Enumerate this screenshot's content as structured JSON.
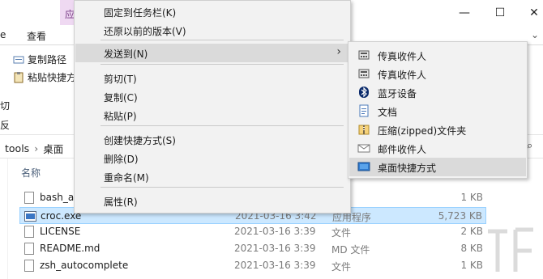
{
  "window": {
    "app_tab_label": "应",
    "ribbon_tabs": [
      "查看"
    ],
    "ribbon_commands": {
      "copy_path": "复制路径",
      "paste_shortcut": "粘贴快捷方",
      "cut_fragment": "切",
      "fragment2": "反"
    },
    "breadcrumb": [
      "tools",
      "桌面"
    ],
    "controls": {
      "minimize": "—",
      "maximize": "☐",
      "close": "✕"
    }
  },
  "file_list": {
    "column_name": "名称",
    "rows": [
      {
        "name": "bash_au",
        "date": "",
        "type": "",
        "size": "1 KB",
        "icon": "file-icon",
        "selected": false
      },
      {
        "name": "croc.exe",
        "date": "2021-03-16 3:42",
        "type": "应用程序",
        "size": "5,723 KB",
        "icon": "exe-icon",
        "selected": true
      },
      {
        "name": "LICENSE",
        "date": "2021-03-16 3:39",
        "type": "文件",
        "size": "2 KB",
        "icon": "file-icon",
        "selected": false
      },
      {
        "name": "README.md",
        "date": "2021-03-16 3:39",
        "type": "MD 文件",
        "size": "8 KB",
        "icon": "file-icon",
        "selected": false
      },
      {
        "name": "zsh_autocomplete",
        "date": "2021-03-16 3:39",
        "type": "文件",
        "size": "1 KB",
        "icon": "file-icon",
        "selected": false
      }
    ]
  },
  "context_menu": {
    "items": [
      {
        "label": "固定到任务栏(K)"
      },
      {
        "label": "还原以前的版本(V)"
      },
      {
        "label": "发送到(N)",
        "has_submenu": true,
        "hover": true
      },
      {
        "label": "剪切(T)"
      },
      {
        "label": "复制(C)"
      },
      {
        "label": "粘贴(P)"
      },
      {
        "label": "创建快捷方式(S)"
      },
      {
        "label": "删除(D)"
      },
      {
        "label": "重命名(M)"
      },
      {
        "label": "属性(R)"
      }
    ]
  },
  "send_to_menu": {
    "items": [
      {
        "label": "传真收件人",
        "icon": "fax-icon"
      },
      {
        "label": "传真收件人",
        "icon": "fax-icon"
      },
      {
        "label": "蓝牙设备",
        "icon": "bluetooth-icon"
      },
      {
        "label": "文档",
        "icon": "documents-icon"
      },
      {
        "label": "压缩(zipped)文件夹",
        "icon": "zip-folder-icon"
      },
      {
        "label": "邮件收件人",
        "icon": "mail-icon"
      },
      {
        "label": "桌面快捷方式",
        "icon": "desktop-icon",
        "hover": true
      }
    ]
  },
  "colors": {
    "selection_fill": "#cce8ff",
    "menu_bg": "#f2f2f2",
    "menu_hover": "#dadada",
    "app_tab": "#efd9f2"
  }
}
